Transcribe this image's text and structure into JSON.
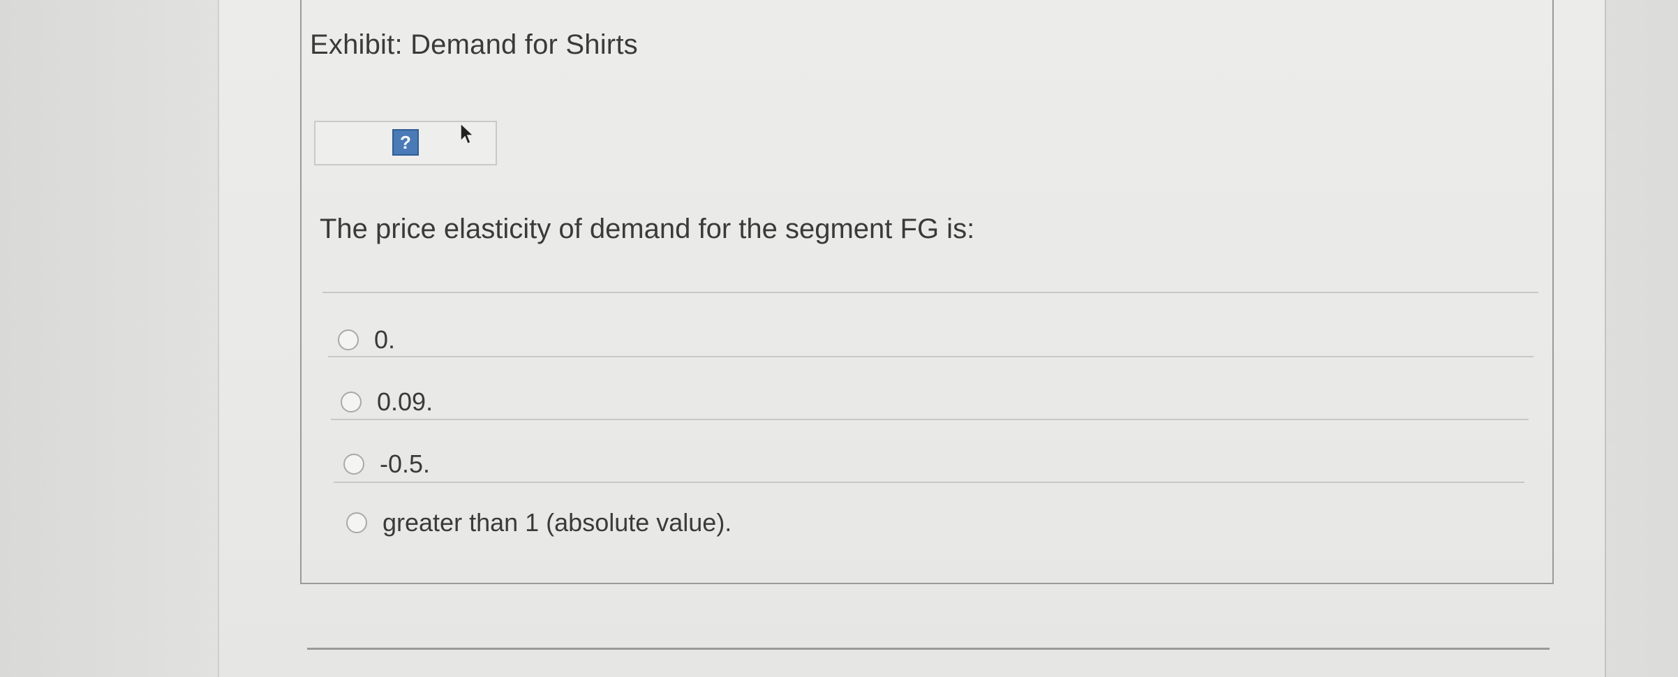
{
  "exhibit": {
    "title": "Exhibit: Demand for Shirts",
    "help_icon_label": "?"
  },
  "question": {
    "text": "The price elasticity of demand for the segment FG is:"
  },
  "options": [
    {
      "label": "0.",
      "selected": false
    },
    {
      "label": "0.09.",
      "selected": false
    },
    {
      "label": "-0.5.",
      "selected": false
    },
    {
      "label": "greater than 1 (absolute value).",
      "selected": false
    }
  ],
  "icons": {
    "help": "help-question-icon",
    "cursor": "mouse-pointer-icon"
  },
  "colors": {
    "help_icon_bg": "#4a7bb7",
    "text": "#3a3a3a"
  }
}
